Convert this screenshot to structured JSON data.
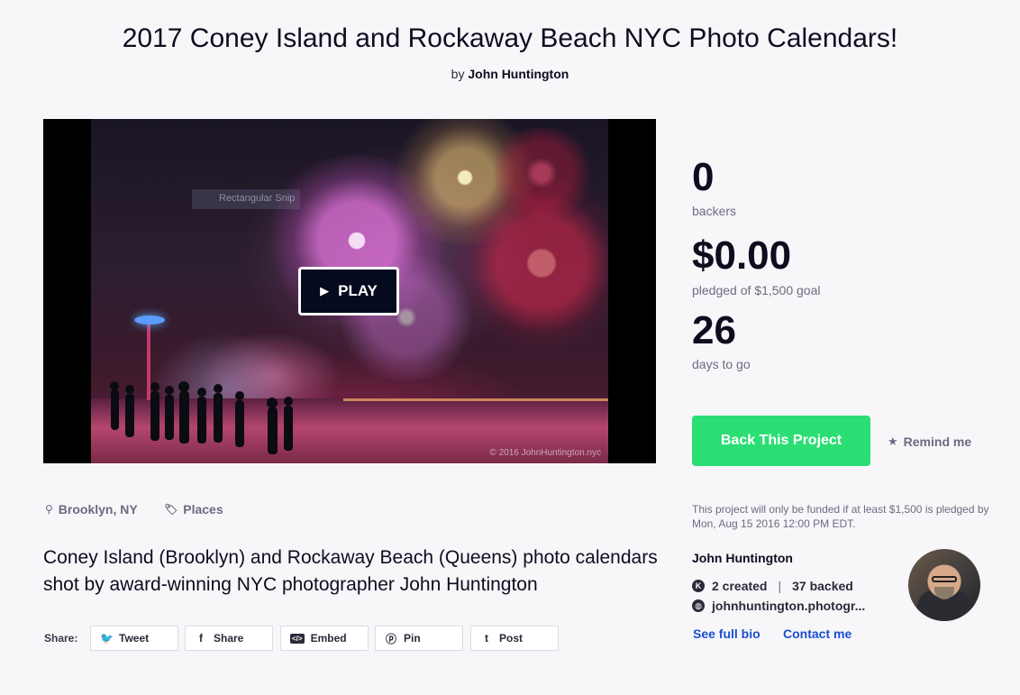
{
  "project": {
    "title": "2017 Coney Island and Rockaway Beach NYC Photo Calendars!",
    "by_prefix": "by",
    "creator": "John Huntington"
  },
  "video": {
    "play_label": "PLAY",
    "overlay_label": "Rectangular Snip",
    "copyright": "© 2016 JohnHuntington.nyc"
  },
  "stats": {
    "backers_value": "0",
    "backers_label": "backers",
    "pledged_value": "$0.00",
    "pledged_label": "pledged of $1,500 goal",
    "days_value": "26",
    "days_label": "days to go"
  },
  "actions": {
    "back_label": "Back This Project",
    "remind_label": "Remind me"
  },
  "funding_note": "This project will only be funded if at least $1,500 is pledged by Mon, Aug 15 2016 12:00 PM EDT.",
  "meta": {
    "location": "Brooklyn, NY",
    "category": "Places"
  },
  "blurb": "Coney Island (Brooklyn) and Rockaway Beach (Queens) photo calendars shot by award-winning NYC photographer John Huntington",
  "share": {
    "label": "Share:",
    "buttons": [
      {
        "label": "Tweet",
        "icon": "twitter-icon"
      },
      {
        "label": "Share",
        "icon": "facebook-icon"
      },
      {
        "label": "Embed",
        "icon": "embed-icon"
      },
      {
        "label": "Pin",
        "icon": "pinterest-icon"
      },
      {
        "label": "Post",
        "icon": "tumblr-icon"
      }
    ]
  },
  "creator_card": {
    "name": "John Huntington",
    "created": "2 created",
    "backed": "37 backed",
    "website": "johnhuntington.photogr...",
    "bio_link": "See full bio",
    "contact_link": "Contact me"
  },
  "colors": {
    "accent_green": "#2bde73",
    "link_blue": "#1b4fd1",
    "background": "#f7f7fa"
  }
}
